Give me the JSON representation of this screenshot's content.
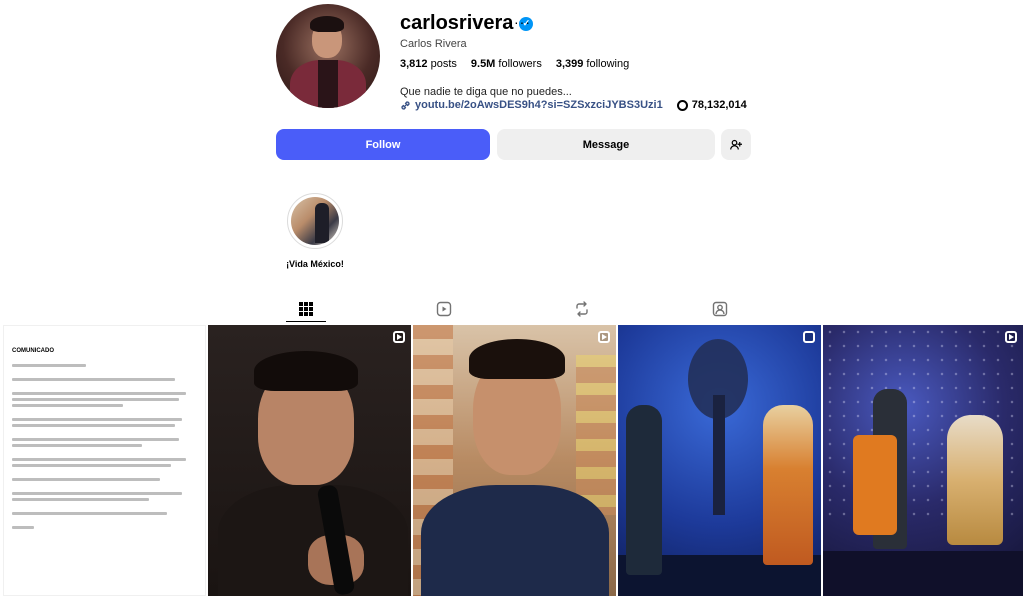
{
  "profile": {
    "username": "carlosrivera",
    "full_name": "Carlos Rivera",
    "more_label": "···",
    "stats": {
      "posts_count": "3,812",
      "posts_label": "posts",
      "followers_count": "9.5M",
      "followers_label": "followers",
      "following_count": "3,399",
      "following_label": "following"
    },
    "bio": "Que nadie te diga que no puedes...",
    "link": "youtu.be/2oAwsDES9h4?si=SZSxzciJYBS3Uzi1",
    "threads_count": "78,132,014"
  },
  "actions": {
    "follow_label": "Follow",
    "message_label": "Message",
    "add_user_icon": "add-user-icon"
  },
  "highlights": [
    {
      "label": "¡Vida México!"
    }
  ],
  "tabs": [
    {
      "icon": "grid-icon",
      "active": true
    },
    {
      "icon": "reels-icon",
      "active": false
    },
    {
      "icon": "repost-icon",
      "active": false
    },
    {
      "icon": "tagged-icon",
      "active": false
    }
  ],
  "posts": [
    {
      "type": "text",
      "title": "COMUNICADO"
    },
    {
      "type": "reel"
    },
    {
      "type": "reel"
    },
    {
      "type": "carousel"
    },
    {
      "type": "reel"
    }
  ],
  "colors": {
    "follow_button": "#4a5df9",
    "verified_badge": "#0095f6",
    "link": "#385185"
  }
}
